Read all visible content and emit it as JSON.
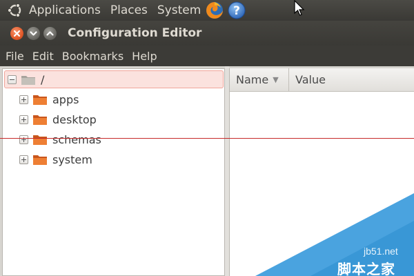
{
  "panel": {
    "menus": [
      "Applications",
      "Places",
      "System"
    ],
    "launchers": [
      "firefox-icon",
      "help-icon"
    ],
    "help_glyph": "?"
  },
  "window": {
    "title": "Configuration Editor"
  },
  "menubar": {
    "items": [
      "File",
      "Edit",
      "Bookmarks",
      "Help"
    ]
  },
  "tree": {
    "root": "/",
    "items": [
      "apps",
      "desktop",
      "schemas",
      "system"
    ]
  },
  "values_table": {
    "columns": [
      "Name",
      "Value"
    ],
    "sort_indicator": "▼"
  },
  "watermark": {
    "site": "jb51.net",
    "brand": "脚本之家"
  },
  "colors": {
    "panel_bg": "#3c3b37",
    "close_button": "#e25a2a",
    "selected_row_bg": "#fbe2de",
    "folder": "#e9742b",
    "red_line": "#c62828",
    "watermark_blue": "#4aa3df"
  }
}
